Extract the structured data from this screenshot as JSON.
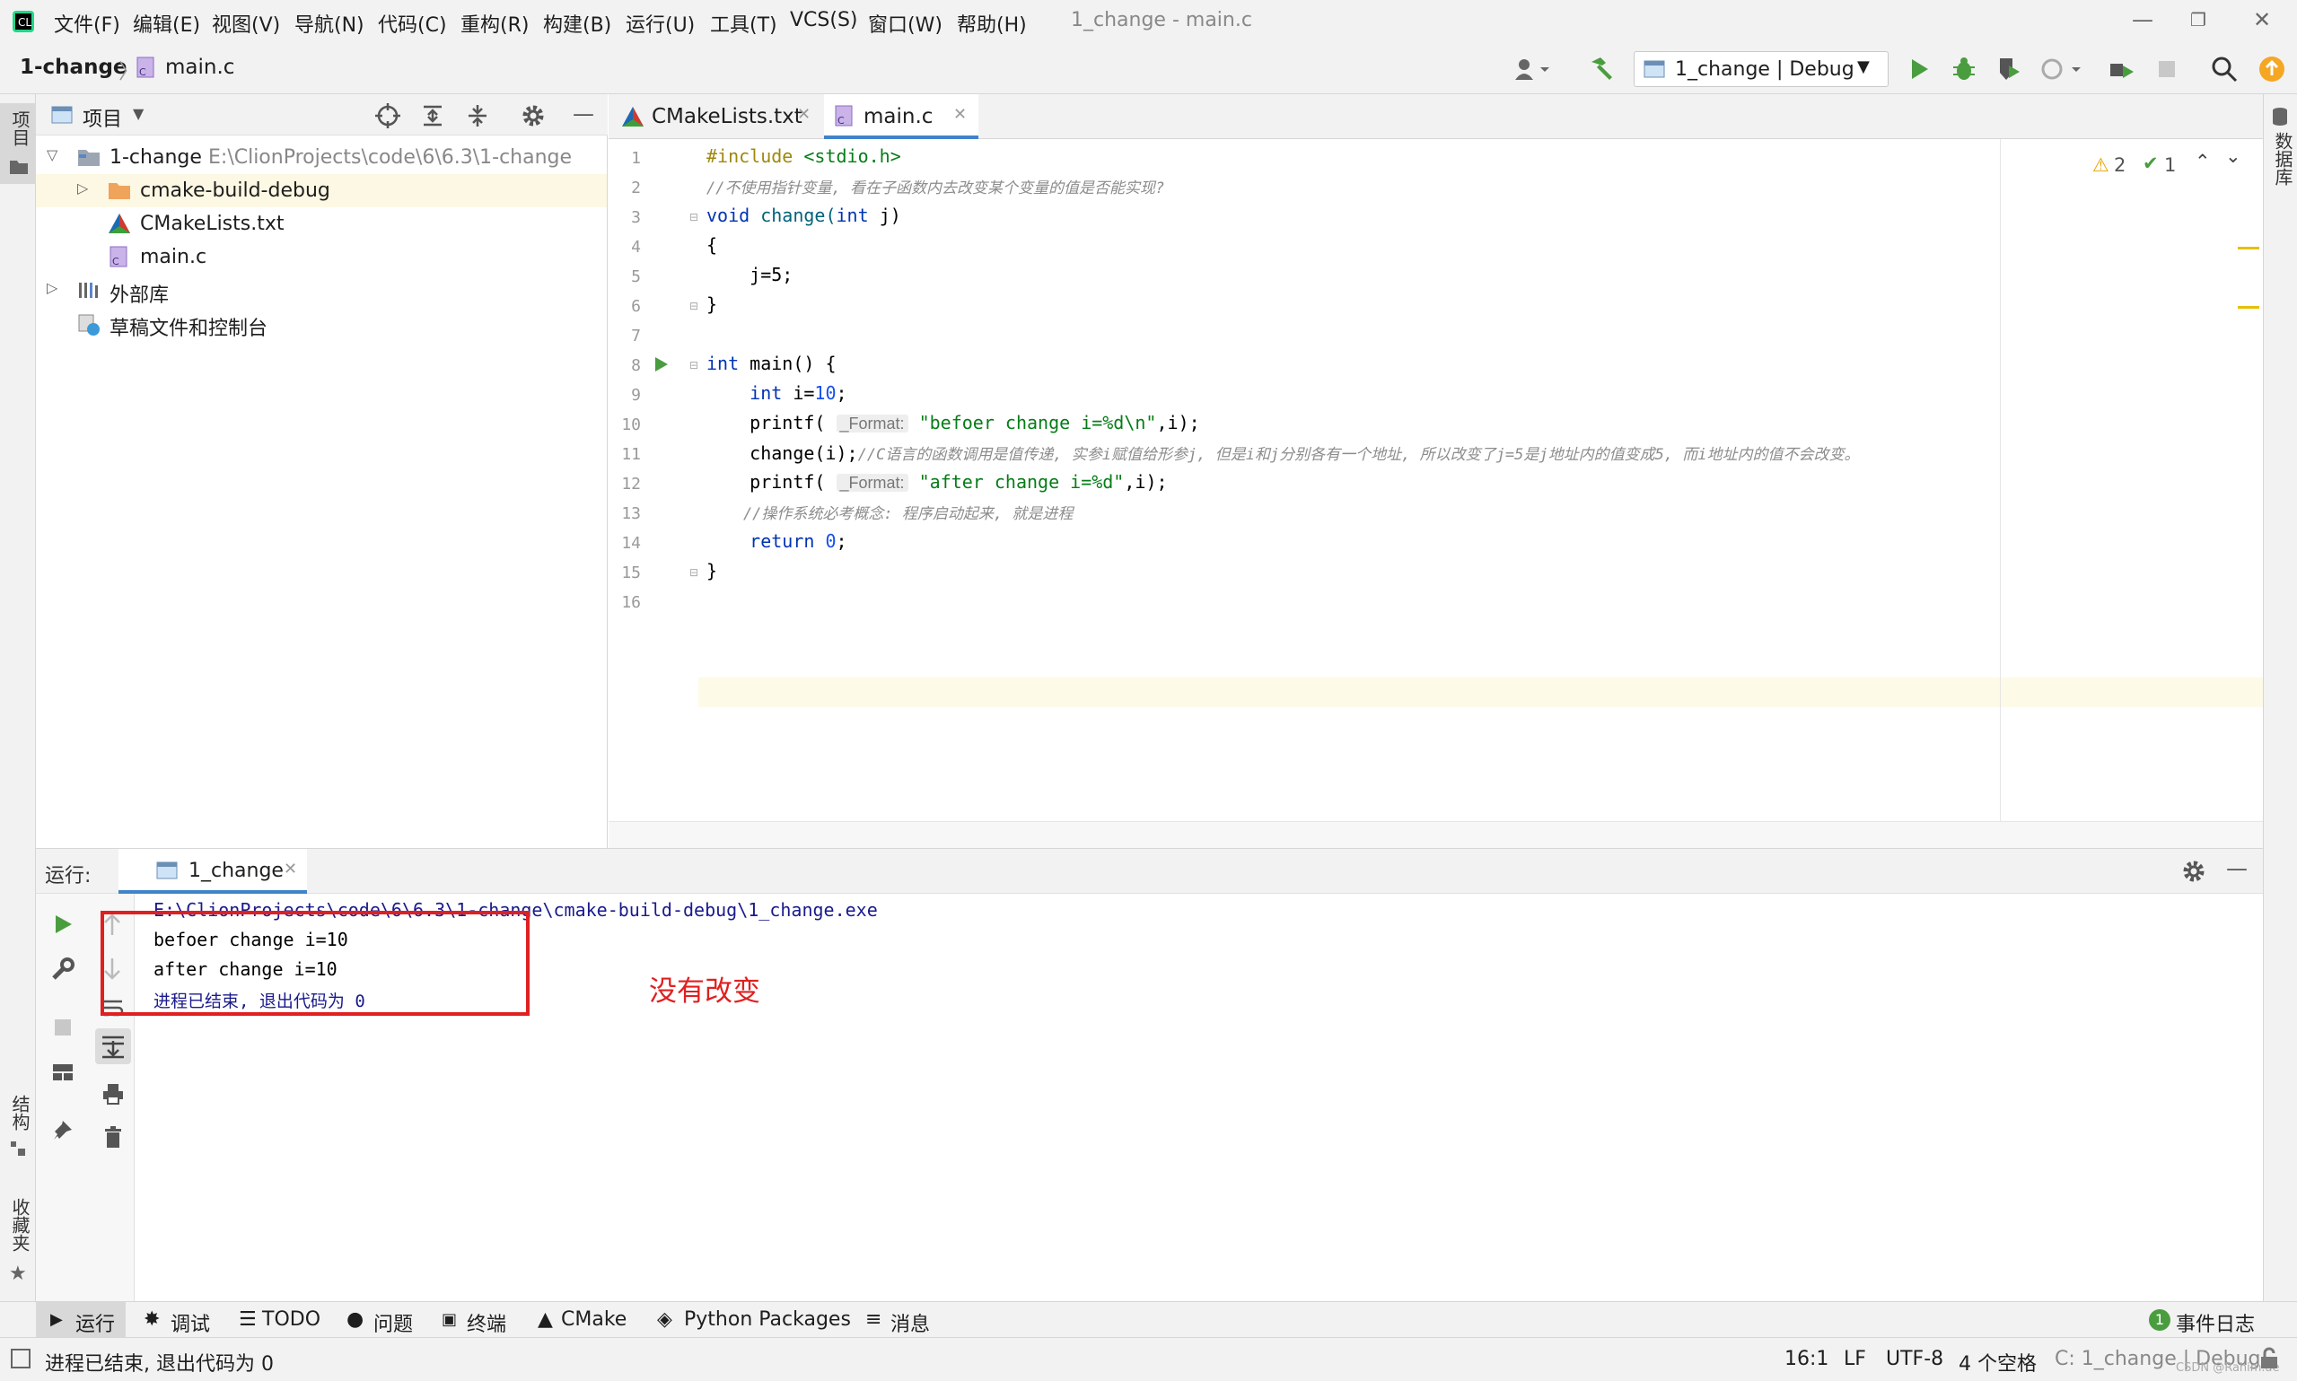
{
  "menu": {
    "items": [
      "文件(F)",
      "编辑(E)",
      "视图(V)",
      "导航(N)",
      "代码(C)",
      "重构(R)",
      "构建(B)",
      "运行(U)",
      "工具(T)",
      "VCS(S)",
      "窗口(W)",
      "帮助(H)"
    ],
    "window_title": "1_change - main.c"
  },
  "nav": {
    "project": "1-change",
    "file": "main.c",
    "run_config": "1_change | Debug"
  },
  "project_panel": {
    "title": "项目",
    "root_name": "1-change",
    "root_path": "E:\\ClionProjects\\code\\6\\6.3\\1-change",
    "items": [
      "cmake-build-debug",
      "CMakeLists.txt",
      "main.c"
    ],
    "external_libs": "外部库",
    "scratches": "草稿文件和控制台"
  },
  "editor": {
    "tabs": [
      "CMakeLists.txt",
      "main.c"
    ],
    "warnings": "2",
    "checks": "1",
    "code": {
      "l1_a": "#include ",
      "l1_b": "<stdio.h>",
      "l2": "//不使用指针变量, 看在子函数内去改变某个变量的值是否能实现?",
      "l3_a": "void ",
      "l3_b": "change(",
      "l3_c": "int ",
      "l3_d": "j)",
      "l4": "{",
      "l5": "    j=5;",
      "l6": "}",
      "l8_a": "int ",
      "l8_b": "main() {",
      "l9_a": "    int ",
      "l9_b": "i=",
      "l9_c": "10",
      "l9_d": ";",
      "l10_a": "    printf( ",
      "l10_hint": "_Format:",
      "l10_b": " \"befoer change i=%d\\n\"",
      "l10_c": ",i);",
      "l11_a": "    change(i);",
      "l11_b": "//C语言的函数调用是值传递, 实参i赋值给形参j, 但是i和j分别各有一个地址, 所以改变了j=5是j地址内的值变成5, 而i地址内的值不会改变。",
      "l12_a": "    printf( ",
      "l12_hint": "_Format:",
      "l12_b": " \"after change i=%d\"",
      "l12_c": ",i);",
      "l13": "    //操作系统必考概念: 程序启动起来, 就是进程",
      "l14_a": "    return ",
      "l14_b": "0",
      "l14_c": ";",
      "l15": "}"
    }
  },
  "run_panel": {
    "label": "运行:",
    "tab": "1_change",
    "output": [
      "E:\\ClionProjects\\code\\6\\6.3\\1-change\\cmake-build-debug\\1_change.exe",
      "befoer change i=10",
      "after change i=10",
      "进程已结束, 退出代码为 0"
    ],
    "annotation": "没有改变"
  },
  "left_strip": {
    "project": "项目",
    "structure": "结构",
    "favorites": "收藏夹"
  },
  "right_strip": {
    "database": "数据库"
  },
  "tool_windows": [
    "运行",
    "调试",
    "TODO",
    "问题",
    "终端",
    "CMake",
    "Python Packages",
    "消息"
  ],
  "event_log": "事件日志",
  "event_count": "1",
  "status": {
    "message": "进程已结束, 退出代码为 0",
    "position": "16:1",
    "line_sep": "LF",
    "encoding": "UTF-8",
    "indent": "4 个空格",
    "context": "C: 1_change | Debug",
    "watermark": "CSDN @Rahim.ae"
  },
  "colors": {
    "accent": "#4a9d3e",
    "annotation_red": "#e02020",
    "warning": "#e5a000"
  }
}
